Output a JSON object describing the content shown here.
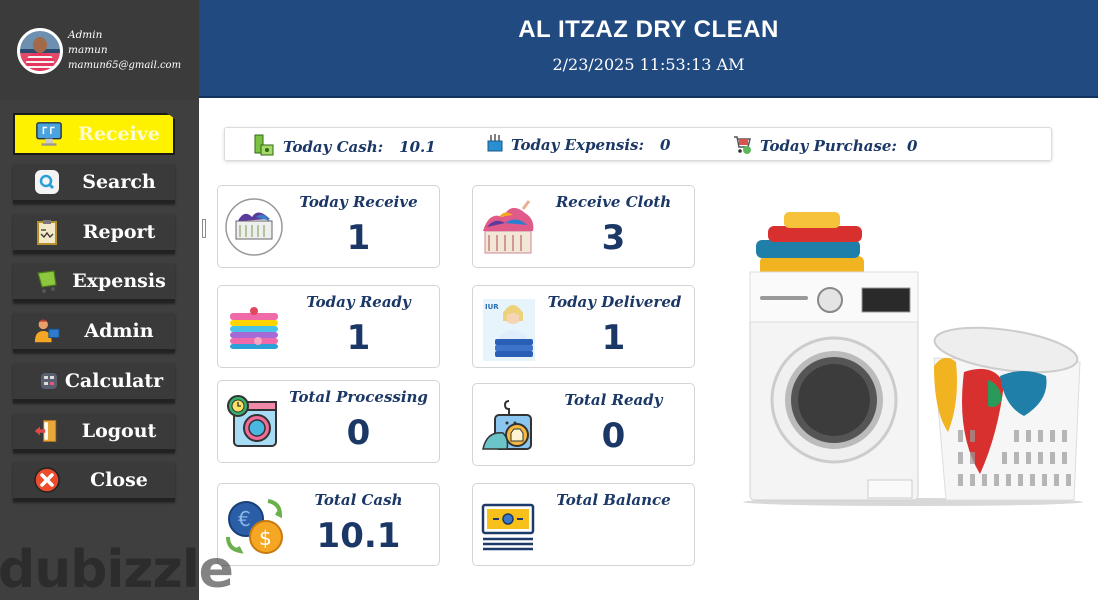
{
  "profile": {
    "role": "Admin",
    "name": "mamun",
    "email": "mamun65@gmail.com"
  },
  "sidebar": {
    "items": [
      {
        "label": "Receive",
        "icon": "monitor-icon",
        "active": true
      },
      {
        "label": "Search",
        "icon": "search-icon",
        "active": false
      },
      {
        "label": "Report",
        "icon": "clipboard-report-icon",
        "active": false
      },
      {
        "label": "Expensis",
        "icon": "cart-expense-icon",
        "active": false
      },
      {
        "label": "Admin",
        "icon": "admin-user-icon",
        "active": false
      },
      {
        "label": "Calculatr",
        "icon": "calculator-icon",
        "active": false
      },
      {
        "label": "Logout",
        "icon": "logout-door-icon",
        "active": false
      },
      {
        "label": "Close",
        "icon": "close-circle-icon",
        "active": false
      }
    ],
    "active_color": "#fff200"
  },
  "header": {
    "title": "AL ITZAZ DRY CLEAN",
    "datetime": "2/23/2025 11:53:13 AM",
    "bg_color": "#214a80"
  },
  "summary": {
    "today_cash_label": "Today Cash:",
    "today_cash_value": "10.1",
    "today_expensis_label": "Today Expensis:",
    "today_expensis_value": "0",
    "today_purchase_label": "Today Purchase:",
    "today_purchase_value": "0"
  },
  "cards": [
    {
      "title": "Today Receive",
      "value": "1",
      "icon": "laundry-basket-icon"
    },
    {
      "title": "Receive Cloth",
      "value": "3",
      "icon": "clothes-pile-icon"
    },
    {
      "title": "Today Ready",
      "value": "1",
      "icon": "folded-towels-icon"
    },
    {
      "title": "Today Delivered",
      "value": "1",
      "icon": "delivery-person-icon"
    },
    {
      "title": "Total Processing",
      "value": "0",
      "icon": "washing-machine-clock-icon"
    },
    {
      "title": "Total Ready",
      "value": "0",
      "icon": "hanger-tag-icon"
    },
    {
      "title": "Total Cash",
      "value": "10.1",
      "icon": "currency-exchange-icon"
    },
    {
      "title": "Total Balance",
      "value": "",
      "icon": "banknote-icon"
    }
  ],
  "text_color": "#1b3766",
  "watermark": {
    "text": "dubizzle"
  }
}
